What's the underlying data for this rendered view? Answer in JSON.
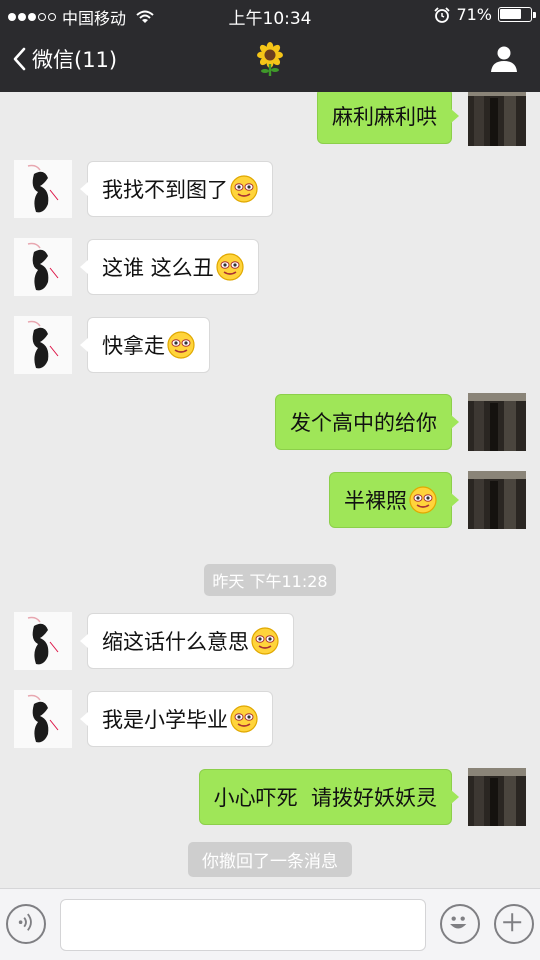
{
  "status_bar": {
    "carrier": "中国移动",
    "time": "上午10:34",
    "battery_percent": "71%",
    "battery_level": 0.71,
    "signal_dots_filled": 3,
    "signal_dots_total": 5
  },
  "nav": {
    "back_label": "微信(11)",
    "title_icon": "sunflower-icon",
    "right_icon": "user-icon"
  },
  "messages": [
    {
      "side": "right",
      "text": "麻利麻利哄",
      "emoji": false
    },
    {
      "side": "left",
      "text": "我找不到图了",
      "emoji": true
    },
    {
      "side": "left",
      "text": "这谁 这么丑",
      "emoji": true
    },
    {
      "side": "left",
      "text": "快拿走",
      "emoji": true
    },
    {
      "side": "right",
      "text": "发个高中的给你",
      "emoji": false
    },
    {
      "side": "right",
      "text": "半裸照",
      "emoji": true
    },
    {
      "side": "left",
      "text": "缩这话什么意思",
      "emoji": true
    },
    {
      "side": "left",
      "text": "我是小学毕业",
      "emoji": true
    },
    {
      "side": "right",
      "text": "小心吓死  请拨好妖妖灵",
      "emoji": false
    }
  ],
  "timestamp": "昨天 下午11:28",
  "recall_notice": "你撤回了一条消息",
  "input_bar": {
    "voice_icon": "voice-icon",
    "input_value": "",
    "emoji_icon": "emoji-icon",
    "plus_icon": "plus-icon"
  },
  "colors": {
    "header_bg": "#2b2b2e",
    "chat_bg": "#ebebeb",
    "sent_bubble": "#9fe658",
    "received_bubble": "#ffffff"
  }
}
